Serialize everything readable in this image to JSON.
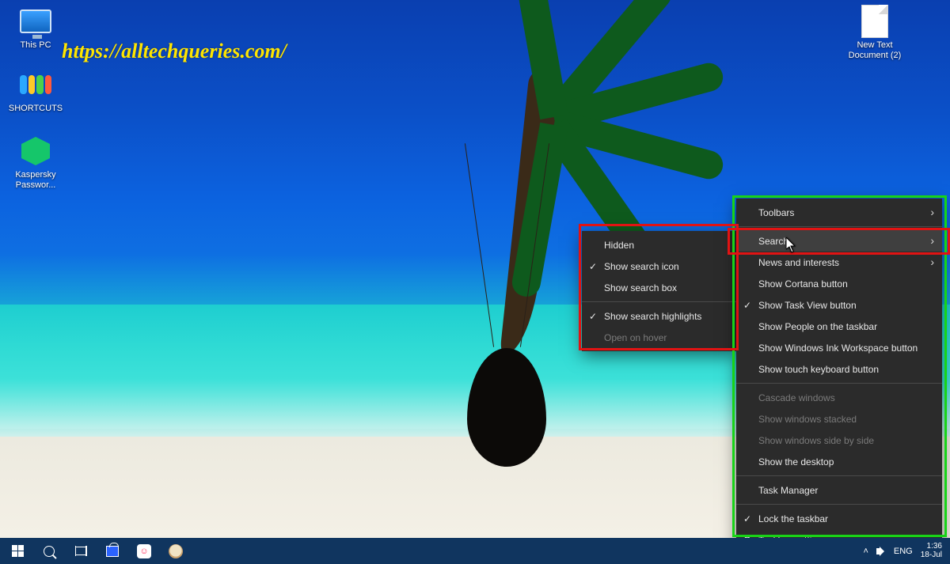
{
  "watermark_text": "https://alltechqueries.com/",
  "desktop_icons": {
    "this_pc": "This PC",
    "shortcuts": "SHORTCUTS",
    "kaspersky": "Kaspersky Passwor...",
    "new_text": "New Text Document (2)"
  },
  "submenu": {
    "hidden": "Hidden",
    "show_icon": "Show search icon",
    "show_box": "Show search box",
    "show_highlights": "Show search highlights",
    "open_hover": "Open on hover"
  },
  "main_menu": {
    "toolbars": "Toolbars",
    "search": "Search",
    "news": "News and interests",
    "cortana": "Show Cortana button",
    "taskview": "Show Task View button",
    "people": "Show People on the taskbar",
    "ink": "Show Windows Ink Workspace button",
    "touchkb": "Show touch keyboard button",
    "cascade": "Cascade windows",
    "stacked": "Show windows stacked",
    "sidebyside": "Show windows side by side",
    "showdesktop": "Show the desktop",
    "taskmgr": "Task Manager",
    "lock": "Lock the taskbar",
    "settings": "Taskbar settings"
  },
  "tray": {
    "lang": "ENG",
    "time": "1:36",
    "date": "18-Jul"
  }
}
